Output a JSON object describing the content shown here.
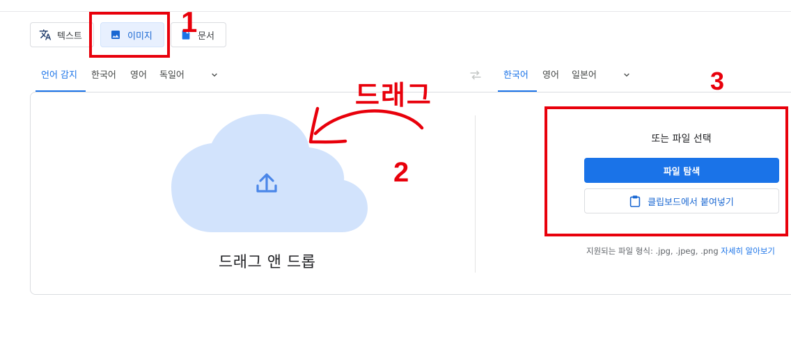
{
  "modes": {
    "text_label": "텍스트",
    "image_label": "이미지",
    "document_label": "문서"
  },
  "source_langs": {
    "items": [
      "언어 감지",
      "한국어",
      "영어",
      "독일어"
    ],
    "active": "언어 감지"
  },
  "target_langs": {
    "items": [
      "한국어",
      "영어",
      "일본어"
    ],
    "active": "한국어"
  },
  "upload": {
    "drop_label": "드래그 앤 드롭",
    "or_choose": "또는 파일 선택",
    "browse_label": "파일 탐색",
    "paste_label": "클립보드에서 붙여넣기",
    "formats_text": "지원되는 파일 형식: .jpg, .jpeg, .png",
    "learn_more": "자세히 알아보기"
  },
  "annotations": {
    "n1": "1",
    "n2": "2",
    "n3": "3",
    "drag": "드래그",
    "color": "#e8000b"
  },
  "colors": {
    "accent": "#1a73e8",
    "cloud": "#d2e3fc",
    "selected_bg": "#e8f0fe"
  }
}
